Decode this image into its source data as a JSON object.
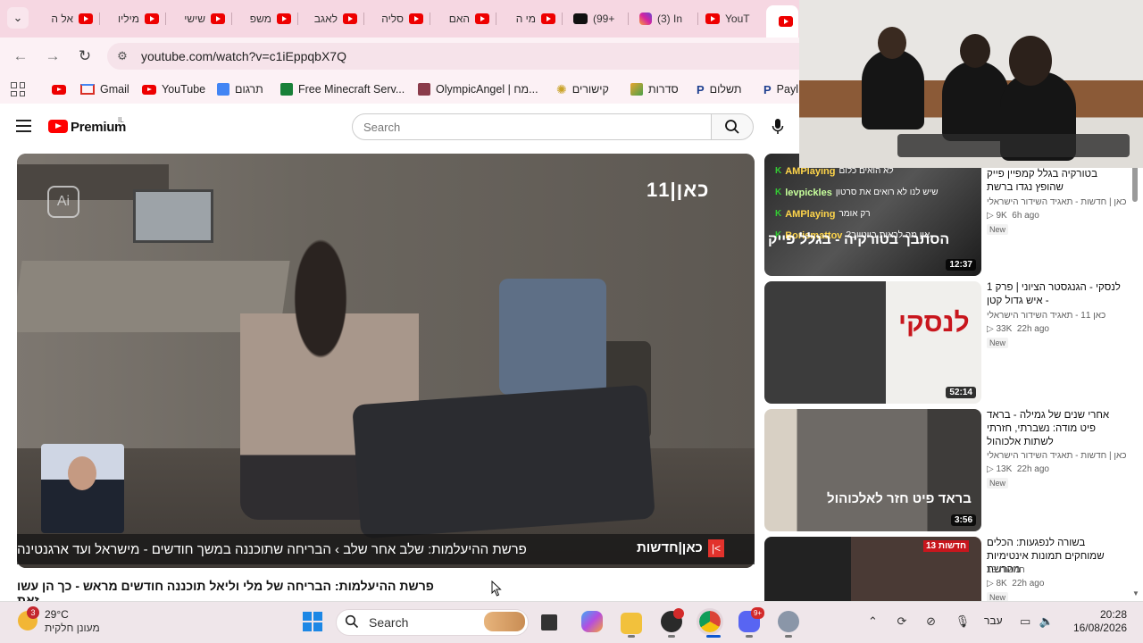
{
  "browser": {
    "tabs": [
      {
        "label": "אל ה",
        "icon": "youtube-icon"
      },
      {
        "label": "מיליו",
        "icon": "youtube-icon"
      },
      {
        "label": "שישי",
        "icon": "youtube-icon"
      },
      {
        "label": "משפ",
        "icon": "youtube-icon"
      },
      {
        "label": "לאגב",
        "icon": "youtube-icon"
      },
      {
        "label": "סליה",
        "icon": "youtube-icon"
      },
      {
        "label": "האם",
        "icon": "youtube-icon"
      },
      {
        "label": "מי ה",
        "icon": "youtube-icon"
      },
      {
        "label": "(99+",
        "icon": "tiktok-icon"
      },
      {
        "label": "(3) In",
        "icon": "instagram-icon"
      },
      {
        "label": "YouT",
        "icon": "youtube-icon"
      }
    ],
    "url": "youtube.com/watch?v=c1iEppqbX7Q",
    "bookmarks": [
      {
        "label": "",
        "icon": "youtube-icon"
      },
      {
        "label": "Gmail",
        "icon": "gmail-icon"
      },
      {
        "label": "YouTube",
        "icon": "youtube-icon"
      },
      {
        "label": "תרגום",
        "icon": "translate-icon"
      },
      {
        "label": "Free Minecraft Serv...",
        "icon": "sheets-icon"
      },
      {
        "label": "OlympicAngel | מח...",
        "icon": "avatar-icon"
      },
      {
        "label": "קישורים",
        "icon": "star-icon"
      },
      {
        "label": "סדרות",
        "icon": "folder-icon"
      },
      {
        "label": "תשלום",
        "icon": "paypal-icon"
      },
      {
        "label": "Payl",
        "icon": "paypal-icon"
      }
    ]
  },
  "youtube": {
    "brand": "Premium",
    "country": "IL",
    "search_placeholder": "Search"
  },
  "video": {
    "channel_logo": "כאן|11",
    "ticker_brand": "כאן|חדשות",
    "ticker_text": "פרשת ההיעלמות: שלב אחר שלב  ›  הבריחה שתוכננה במשך חודשים - מישראל ועד ארגנטינה",
    "title": "פרשת ההיעלמות: הבריחה של מלי וליאל תוכננה חודשים מראש - כך הן עשו זאת"
  },
  "recommendations": [
    {
      "title": "בטורקיה בגלל קמפיין פייק שהופץ נגדו ברשת",
      "channel": "כאן | חדשות - תאגיד השידור הישראלי",
      "views": "9K",
      "age": "6h ago",
      "badge": "New",
      "duration": "12:37",
      "overlay_chat": [
        {
          "user": "AMPlaying",
          "msg": "לא הואים כלום"
        },
        {
          "user": "levpickles",
          "msg": "שיש לנו לא רואים את סרטון"
        },
        {
          "user": "AMPlaying",
          "msg": "רק אומר"
        },
        {
          "user": "Borismattov",
          "msg": "אין מה לראות ביוטיוב?"
        }
      ],
      "thumb_text": "הסתבך בטורקיה - בגלל פייק"
    },
    {
      "title": "לנסקי - הגנגסטר הציוני | פרק 1 - איש גדול קטן",
      "channel": "כאן 11 - תאגיד השידור הישראלי",
      "views": "33K",
      "age": "22h ago",
      "badge": "New",
      "duration": "52:14",
      "thumb_text": "לנסקי"
    },
    {
      "title": "אחרי שנים של גמילה - בראד פיט מודה: נשברתי, חזרתי לשתות אלכוהול",
      "channel": "כאן | חדשות - תאגיד השידור הישראלי",
      "views": "13K",
      "age": "22h ago",
      "badge": "New",
      "duration": "3:56",
      "thumb_text": "בראד פיט חזר לאלכוהול"
    },
    {
      "title": "בשורה לנפגעות: הכלים שמוחקים תמונות אינטימיות מהרשת",
      "channel": "חדשות 13",
      "views": "8K",
      "age": "22h ago",
      "badge": "New",
      "duration": "",
      "thumb_text": "חדשות 13"
    }
  ],
  "taskbar": {
    "weather_badge": "3",
    "temperature": "29°C",
    "weather_condition": "מעונן חלקית",
    "search_label": "Search",
    "language": "עבר",
    "time": "20:28",
    "date": "16/08/2026",
    "discord_badge": "9+"
  }
}
